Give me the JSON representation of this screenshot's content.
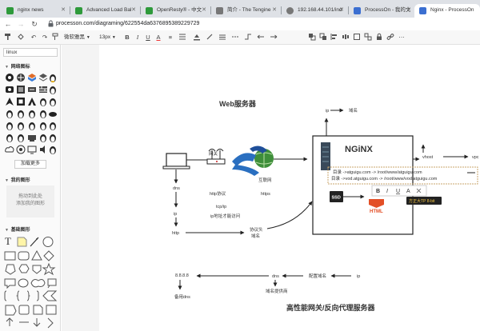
{
  "browser": {
    "tabs": [
      {
        "title": "nginx news",
        "favicon_color": "#2e9a3b"
      },
      {
        "title": "Advanced Load Bal",
        "favicon_color": "#2e9a3b"
      },
      {
        "title": "OpenResty® - 中文",
        "favicon_color": "#2e9a3b"
      },
      {
        "title": "简介 - The Tengine",
        "favicon_color": "#777777"
      },
      {
        "title": "192.168.44.101/ind",
        "favicon_color": "#777777"
      },
      {
        "title": "ProcessOn - 我的文",
        "favicon_color": "#3b6fd1"
      },
      {
        "title": "Nginx - ProcessOn",
        "favicon_color": "#3b6fd1"
      }
    ],
    "url": "processon.com/diagraming/622554da6376895389229729"
  },
  "toolbar": {
    "undo": "↶",
    "redo": "↷",
    "format_painter": "🖌",
    "font_family": "微软雅黑",
    "font_size": "13px",
    "bold": "B",
    "italic": "I",
    "underline": "U",
    "font_color": "A",
    "align": "≡",
    "fill_icon": "fill-icon",
    "line_icon": "line-icon",
    "more": "⋯"
  },
  "sidebar": {
    "search_value": "linux",
    "network_section": "网络图标",
    "load_more": "加载更多",
    "my_shapes_section": "我的图形",
    "my_shapes_hint_line1": "拖动到此处",
    "my_shapes_hint_line2": "添加我的图形",
    "basic_shapes_section": "基础图形",
    "text_shape": "T"
  },
  "diagram": {
    "title_web": "Web服务器",
    "title_gateway": "高性能网关/反向代理服务器",
    "nginx_logo": "NGiNX",
    "html_badge": "HTML",
    "ssd_label": "SSD",
    "ip_top": "ip",
    "domain_top": "域名",
    "vhost": "vhost",
    "vhost_right": "vpc",
    "gateway": "网关",
    "internet": "互联网",
    "dns": "dns",
    "ip": "ip",
    "http": "http",
    "http_protocol": "http协议",
    "https": "https",
    "tcp_ip": "tcp/ip",
    "ip_addr_found": "ip地址才能访问",
    "protocol_header_1": "协议头",
    "protocol_header_2": "域名",
    "dir_line_1": "目录 ->atguigu.com -> /root/www/atguigu.com",
    "dir_line_2": "目录 ->vod.atguigu.com -> /root/www/vod.atguigu.com",
    "bottom_ip1": "8.8.8.8",
    "bottom_dns": "dns",
    "bottom_config_domain": "配置域名",
    "bottom_ip2": "ip",
    "bottom_backup_dns": "备用dns",
    "bottom_domain_provider": "域名提供商",
    "tooltip": "方正大TP 8-bit"
  }
}
